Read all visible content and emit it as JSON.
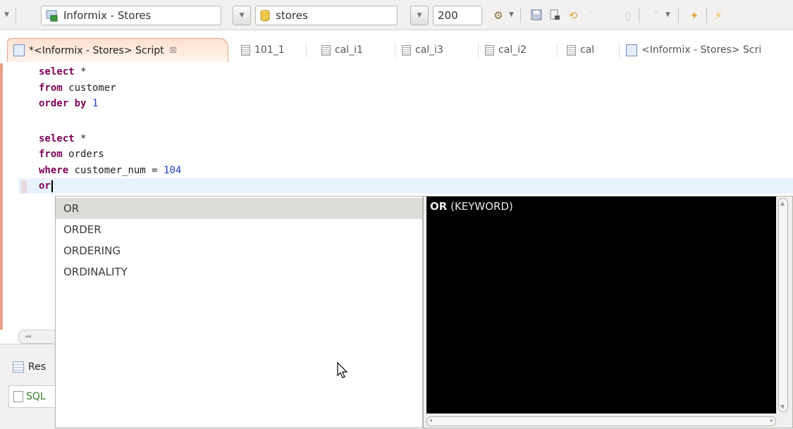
{
  "toolbar": {
    "connection": "Informix - Stores",
    "database": "stores",
    "max_rows": "200",
    "icons": [
      "dropdown-arrow-icon",
      "database-connection-icon",
      "database-icon",
      "run-sql-icon",
      "save-icon",
      "export-icon",
      "refresh-icon",
      "new-connection-icon",
      "bookmark-icon",
      "lightning-icon"
    ]
  },
  "tabs": [
    {
      "label": "*<Informix - Stores> Script",
      "active": true,
      "close": "☒"
    },
    {
      "label": "101_1"
    },
    {
      "label": "cal_i1"
    },
    {
      "label": "cal_i3"
    },
    {
      "label": "cal_i2"
    },
    {
      "label": "cal"
    },
    {
      "label": "<Informix - Stores> Scri"
    }
  ],
  "editor": {
    "lines": [
      {
        "kw": "select",
        "rest": " *"
      },
      {
        "kw": "from",
        "rest": " customer"
      },
      {
        "kw": "order by",
        "rest": " ",
        "num": "1"
      },
      {
        "kw": "",
        "rest": ""
      },
      {
        "kw": "select",
        "rest": " *"
      },
      {
        "kw": "from",
        "rest": " orders"
      },
      {
        "kw": "where",
        "rest": " customer_num = ",
        "num": "104"
      },
      {
        "kw": "or",
        "rest": ""
      }
    ]
  },
  "bottom": {
    "results_label": "Res",
    "sql_label": "SQL"
  },
  "autocomplete": {
    "proposals": [
      "OR",
      "ORDER",
      "ORDERING",
      "ORDINALITY"
    ],
    "selected_index": 0,
    "info_title": "OR",
    "info_kind": "(KEYWORD)"
  }
}
